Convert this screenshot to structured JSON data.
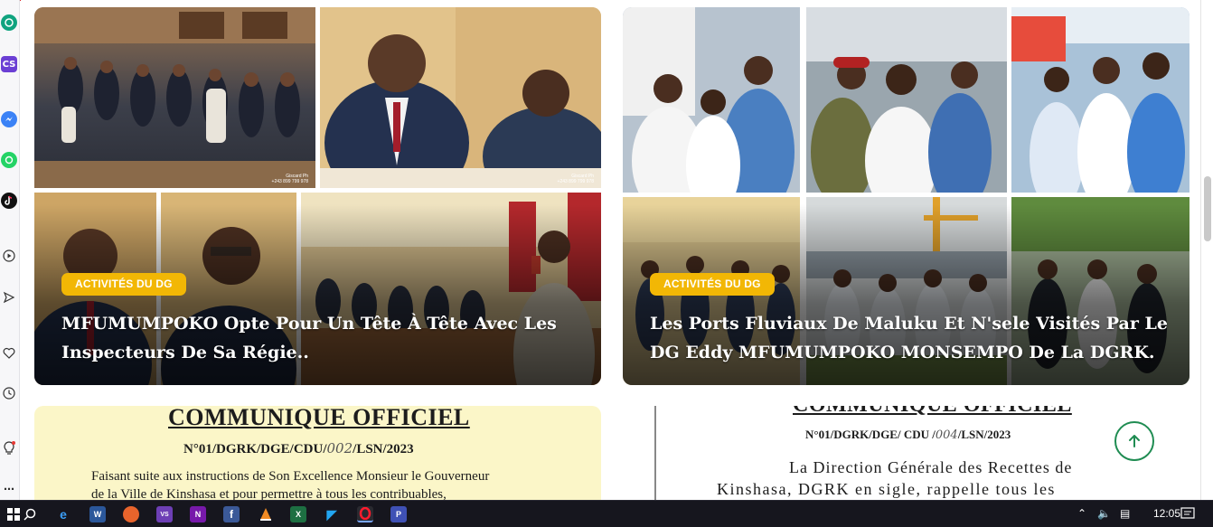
{
  "articles": [
    {
      "category": "ACTIVITÉS DU DG",
      "title": "MFUMUMPOKO Opte Pour Un Tête À Tête Avec Les Inspecteurs De Sa Régie.."
    },
    {
      "category": "ACTIVITÉS DU DG",
      "title": "Les Ports Fluviaux De Maluku Et N'sele Visités Par Le DG Eddy MFUMUMPOKO MONSEMPO De La DGRK."
    }
  ],
  "photo_credit": {
    "line1": "Giscard Ph",
    "line2": "+243 899 799 978"
  },
  "documents": [
    {
      "title": "COMMUNIQUE OFFICIEL",
      "reference": "N°01/DGRK/DGE/CDU/",
      "ref_hand": "002",
      "ref_suffix": "/LSN/2023",
      "body_line1": "Faisant suite aux instructions de Son Excellence Monsieur le Gouverneur",
      "body_line2": "de la Ville de Kinshasa et pour permettre à tous les contribuables,"
    },
    {
      "title": "COMMUNIQUE OFFICIEL",
      "reference": "N°01/DGRK/DGE/ CDU /",
      "ref_hand": "004",
      "ref_suffix": "/LSN/2023",
      "body_line1": "La Direction Générale des Recettes de",
      "body_line2": "Kinshasa, DGRK en sigle, rappelle tous les"
    }
  ],
  "sidebar_icons": [
    "chatgpt-icon",
    "cs-icon",
    "messenger-icon",
    "whatsapp-icon",
    "tiktok-icon",
    "play-icon",
    "send-icon",
    "heart-icon",
    "clock-icon",
    "lightbulb-icon",
    "more-icon"
  ],
  "sidebar_cs_label": "CS",
  "taskbar": {
    "clock": "12:05",
    "word_label": "W",
    "visio_label": "VS",
    "onenote_label": "N",
    "fb_label": "f",
    "excel_label": "X",
    "opera_label": "O",
    "app_label": "P"
  },
  "colors": {
    "badge": "#f2b705",
    "accent_green": "#1f8c52",
    "taskbar": "#16161e"
  }
}
